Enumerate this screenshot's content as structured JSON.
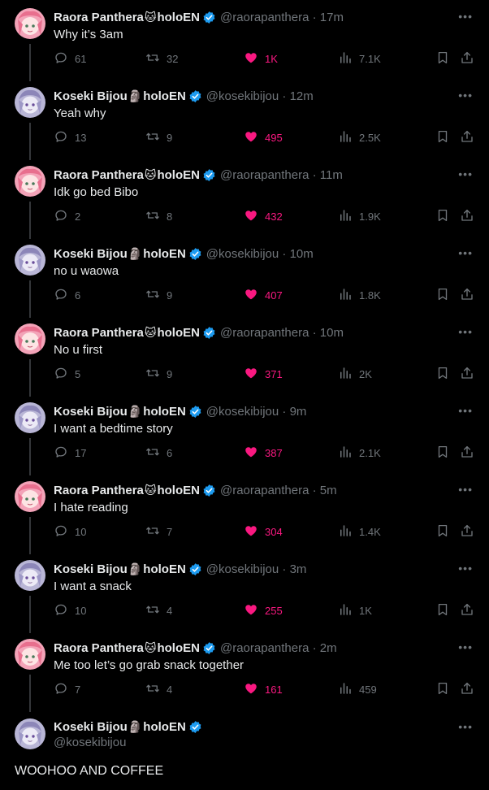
{
  "colors": {
    "like": "#f91880",
    "muted": "#71767b",
    "verified": "#1d9bf0",
    "line": "#333639"
  },
  "icons": {
    "reply": "comment-icon",
    "retweet": "retweet-icon",
    "like": "heart-icon",
    "views": "views-bar-icon",
    "bookmark": "bookmark-icon",
    "share": "share-icon",
    "more": "more-dots-icon"
  },
  "tweets": [
    {
      "name": "Raora Panthera",
      "emoji": "🐱",
      "suffix": "holoEN",
      "handle": "@raorapanthera · 17m",
      "text": "Why it’s 3am",
      "replies": "61",
      "retweets": "32",
      "likes": "1K",
      "views": "7.1K",
      "avatar": "raora"
    },
    {
      "name": "Koseki Bijou",
      "emoji": "🗿",
      "suffix": "holoEN",
      "handle": "@kosekibijou · 12m",
      "text": "Yeah why",
      "replies": "13",
      "retweets": "9",
      "likes": "495",
      "views": "2.5K",
      "avatar": "bijou"
    },
    {
      "name": "Raora Panthera",
      "emoji": "🐱",
      "suffix": "holoEN",
      "handle": "@raorapanthera · 11m",
      "text": "Idk go bed Bibo",
      "replies": "2",
      "retweets": "8",
      "likes": "432",
      "views": "1.9K",
      "avatar": "raora"
    },
    {
      "name": "Koseki Bijou",
      "emoji": "🗿",
      "suffix": "holoEN",
      "handle": "@kosekibijou · 10m",
      "text": "no u waowa",
      "replies": "6",
      "retweets": "9",
      "likes": "407",
      "views": "1.8K",
      "avatar": "bijou"
    },
    {
      "name": "Raora Panthera",
      "emoji": "🐱",
      "suffix": "holoEN",
      "handle": "@raorapanthera · 10m",
      "text": "No u first",
      "replies": "5",
      "retweets": "9",
      "likes": "371",
      "views": "2K",
      "avatar": "raora"
    },
    {
      "name": "Koseki Bijou",
      "emoji": "🗿",
      "suffix": "holoEN",
      "handle": "@kosekibijou · 9m",
      "text": "I want a bedtime story",
      "replies": "17",
      "retweets": "6",
      "likes": "387",
      "views": "2.1K",
      "avatar": "bijou"
    },
    {
      "name": "Raora Panthera",
      "emoji": "🐱",
      "suffix": "holoEN",
      "handle": "@raorapanthera · 5m",
      "text": "I hate reading",
      "replies": "10",
      "retweets": "7",
      "likes": "304",
      "views": "1.4K",
      "avatar": "raora"
    },
    {
      "name": "Koseki Bijou",
      "emoji": "🗿",
      "suffix": "holoEN",
      "handle": "@kosekibijou · 3m",
      "text": "I want a snack",
      "replies": "10",
      "retweets": "4",
      "likes": "255",
      "views": "1K",
      "avatar": "bijou"
    },
    {
      "name": "Raora Panthera",
      "emoji": "🐱",
      "suffix": "holoEN",
      "handle": "@raorapanthera · 2m",
      "text": "Me too let’s go grab snack together",
      "replies": "7",
      "retweets": "4",
      "likes": "161",
      "views": "459",
      "avatar": "raora"
    }
  ],
  "main_tweet": {
    "name": "Koseki Bijou",
    "emoji": "🗿",
    "suffix": "holoEN",
    "handle": "@kosekibijou",
    "text": "WOOHOO AND COFFEE",
    "avatar": "bijou"
  }
}
